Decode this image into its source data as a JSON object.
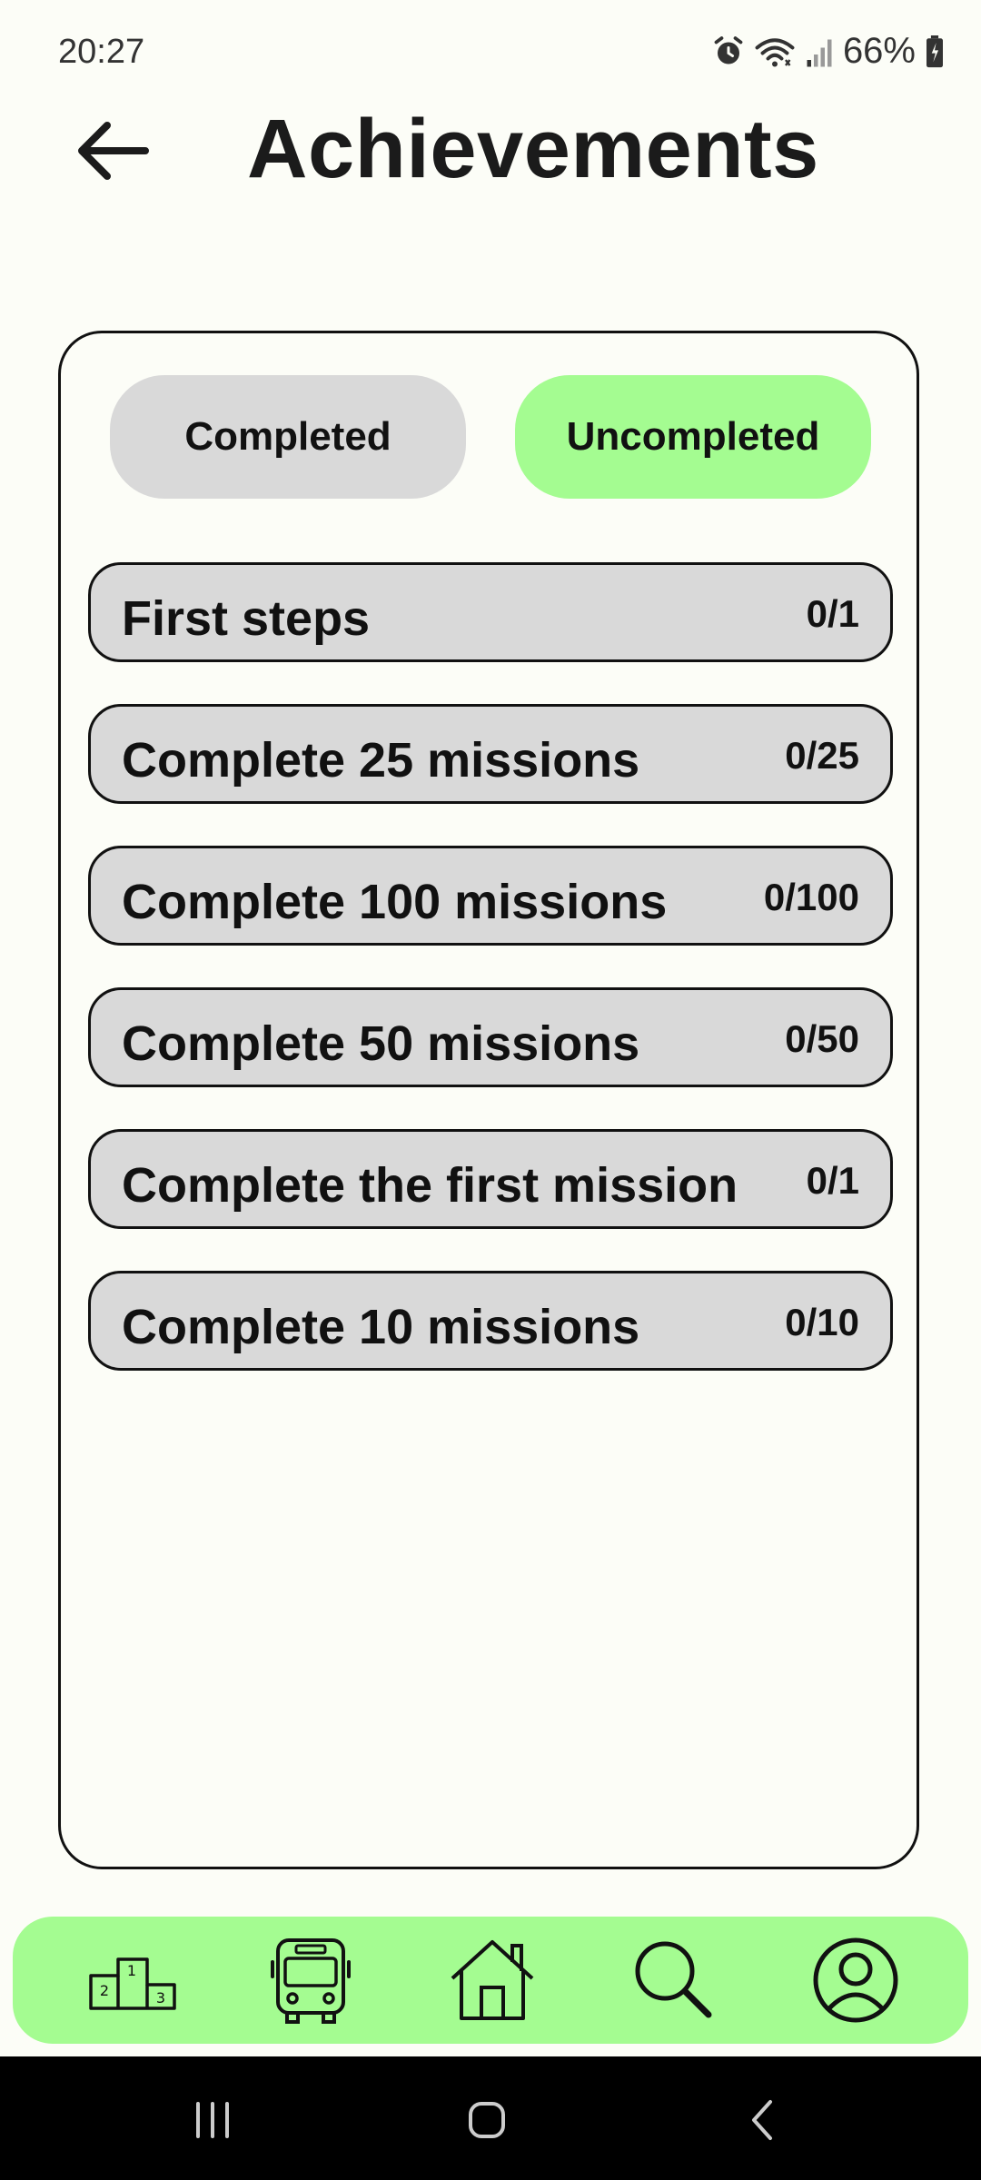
{
  "status_bar": {
    "time": "20:27",
    "battery": "66%",
    "icons": [
      "alarm-icon",
      "wifi-icon",
      "signal-icon",
      "battery-icon"
    ]
  },
  "header": {
    "title": "Achievements",
    "back_icon": "arrow-left-icon"
  },
  "tabs": [
    {
      "label": "Completed",
      "active": false
    },
    {
      "label": "Uncompleted",
      "active": true
    }
  ],
  "achievements": [
    {
      "name": "First steps",
      "progress": "0/1"
    },
    {
      "name": "Complete 25 missions",
      "progress": "0/25"
    },
    {
      "name": "Complete 100 missions",
      "progress": "0/100"
    },
    {
      "name": "Complete 50 missions",
      "progress": "0/50"
    },
    {
      "name": "Complete the first mission",
      "progress": "0/1"
    },
    {
      "name": "Complete 10 missions",
      "progress": "0/10"
    }
  ],
  "bottom_nav": {
    "items": [
      "podium-icon",
      "bus-icon",
      "home-icon",
      "search-icon",
      "profile-icon"
    ]
  },
  "colors": {
    "accent": "#a4fc91",
    "item_bg": "#d9d9d9",
    "page_bg": "#fcfdf7"
  }
}
